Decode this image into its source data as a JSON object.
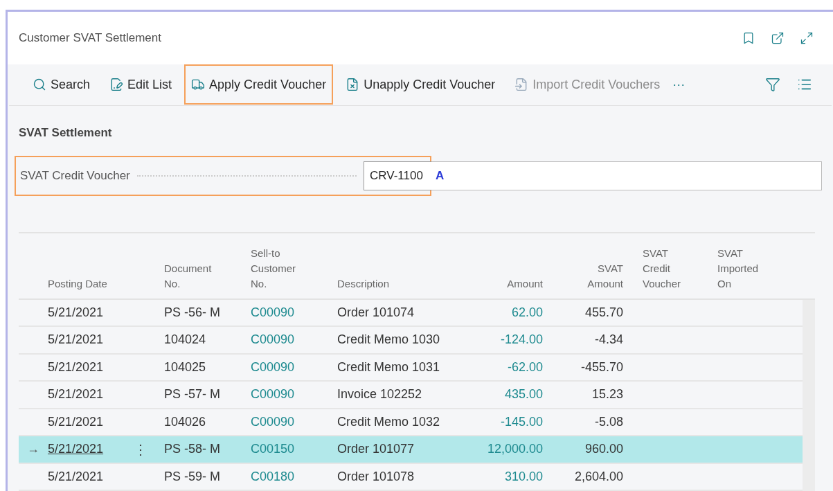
{
  "window": {
    "title": "Customer SVAT Settlement"
  },
  "actions": [
    {
      "label": "Search",
      "kind": "search",
      "highlighted": false,
      "disabled": false
    },
    {
      "label": "Edit List",
      "kind": "edit",
      "highlighted": false,
      "disabled": false
    },
    {
      "label": "Apply Credit Voucher",
      "kind": "apply",
      "highlighted": true,
      "disabled": false
    },
    {
      "label": "Unapply Credit Voucher",
      "kind": "unapply",
      "highlighted": false,
      "disabled": false
    },
    {
      "label": "Import Credit Vouchers",
      "kind": "import",
      "highlighted": false,
      "disabled": true
    }
  ],
  "more": "···",
  "section": {
    "title": "SVAT Settlement",
    "field": {
      "label": "SVAT Credit Voucher",
      "value": "CRV-1100",
      "marker": "A",
      "highlighted": true
    }
  },
  "table": {
    "columns": [
      {
        "label": "Posting Date",
        "kind": "text"
      },
      {
        "label": "Document No.",
        "kind": "text"
      },
      {
        "label": "Sell-to Customer No.",
        "kind": "text"
      },
      {
        "label": "Description",
        "kind": "text"
      },
      {
        "label": "Amount",
        "kind": "number"
      },
      {
        "label": "SVAT Amount",
        "kind": "number"
      },
      {
        "label": "SVAT Credit Voucher",
        "kind": "text"
      },
      {
        "label": "SVAT Imported On",
        "kind": "text"
      }
    ],
    "current_marker": "→",
    "row_menu": "⋮",
    "rows": [
      {
        "selected": false,
        "cells": [
          "5/21/2021",
          "PS -56- M",
          "C00090",
          "Order 101074",
          "62.00",
          "455.70"
        ]
      },
      {
        "selected": false,
        "cells": [
          "5/21/2021",
          "104024",
          "C00090",
          "Credit Memo 1030",
          "-124.00",
          "-4.34"
        ]
      },
      {
        "selected": false,
        "cells": [
          "5/21/2021",
          "104025",
          "C00090",
          "Credit Memo 1031",
          "-62.00",
          "-455.70"
        ]
      },
      {
        "selected": false,
        "cells": [
          "5/21/2021",
          "PS -57- M",
          "C00090",
          "Invoice 102252",
          "435.00",
          "15.23"
        ]
      },
      {
        "selected": false,
        "cells": [
          "5/21/2021",
          "104026",
          "C00090",
          "Credit Memo 1032",
          "-145.00",
          "-5.08"
        ]
      },
      {
        "selected": true,
        "cells": [
          "5/21/2021",
          "PS -58- M",
          "C00150",
          "Order 101077",
          "12,000.00",
          "960.00"
        ]
      },
      {
        "selected": false,
        "cells": [
          "5/21/2021",
          "PS -59- M",
          "C00180",
          "Order 101078",
          "310.00",
          "2,604.00"
        ]
      }
    ]
  }
}
